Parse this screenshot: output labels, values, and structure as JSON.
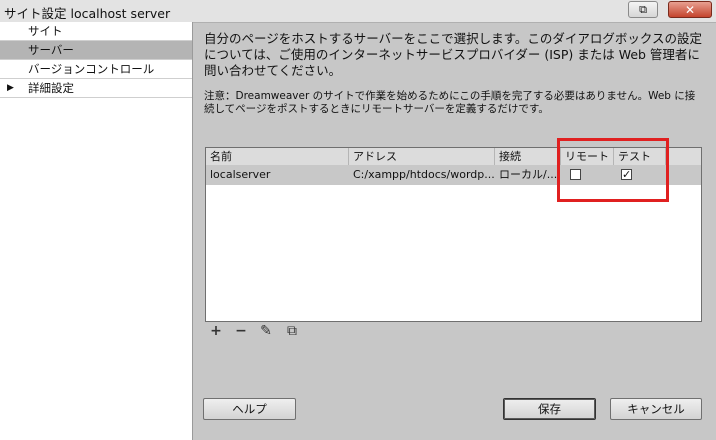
{
  "window": {
    "title": "サイト設定 localhost server",
    "restore_symbol": "⧉",
    "close_symbol": "✕"
  },
  "sidebar": {
    "items": [
      {
        "label": "サイト"
      },
      {
        "label": "サーバー"
      },
      {
        "label": "バージョンコントロール"
      },
      {
        "label": "詳細設定",
        "arrow": "▶"
      }
    ],
    "selected": "サーバー"
  },
  "main": {
    "description": "自分のページをホストするサーバーをここで選択します。このダイアログボックスの設定については、ご使用のインターネットサービスプロバイダー (ISP) または Web 管理者に問い合わせてください。",
    "note": "注意：Dreamweaver のサイトで作業を始めるためにこの手順を完了する必要はありません。Web に接続してページをポストするときにリモートサーバーを定義するだけです。"
  },
  "server_table": {
    "columns": [
      "名前",
      "アドレス",
      "接続",
      "リモート",
      "テスト"
    ],
    "rows": [
      {
        "name": "localserver",
        "address": "C:/xampp/htdocs/wordp...",
        "connection": "ローカル/...",
        "remote": false,
        "test": true
      }
    ]
  },
  "toolbar": {
    "add": "+",
    "remove": "−",
    "edit": "✎",
    "duplicate": "⧉"
  },
  "buttons": {
    "help": "ヘルプ",
    "save": "保存",
    "cancel": "キャンセル"
  },
  "checkmark": "✓"
}
